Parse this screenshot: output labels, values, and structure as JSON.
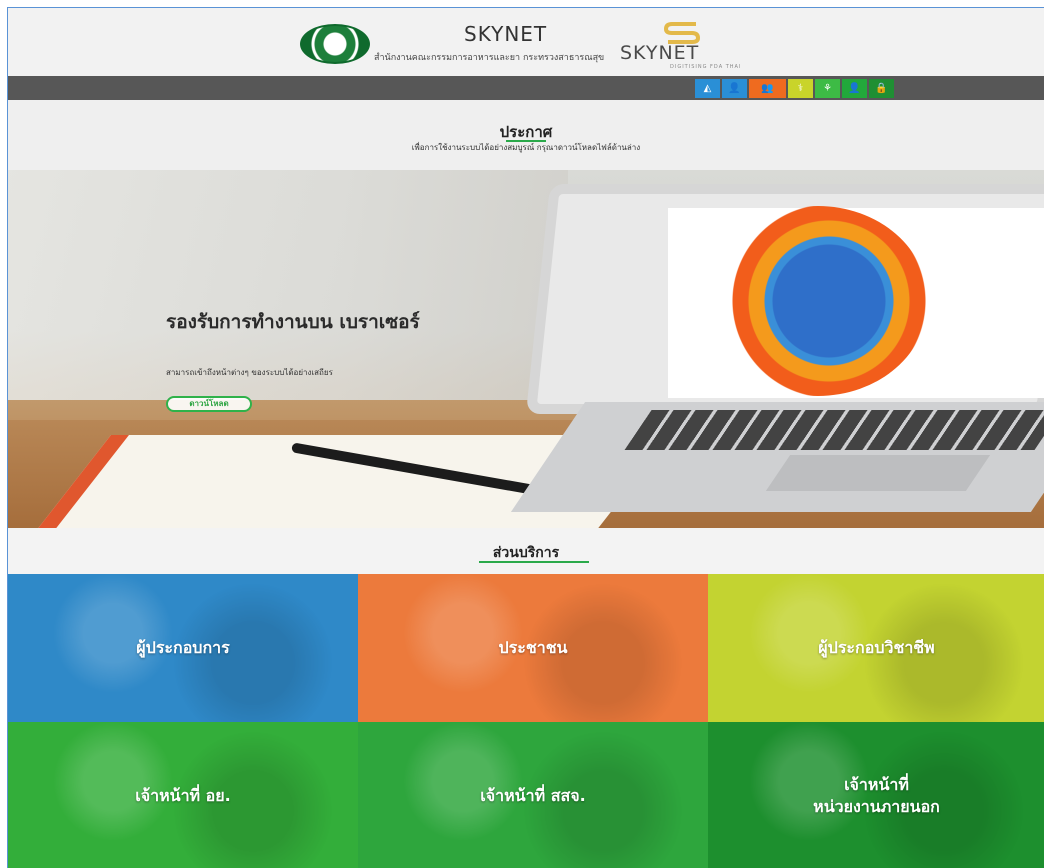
{
  "header": {
    "brand_title": "SKYNET",
    "brand_subtitle": "สำนักงานคณะกรรมการอาหารและยา กระทรวงสาธารณสุข",
    "logo_word": "SKYNET",
    "logo_tagline": "DIGITISING FDA THAI"
  },
  "nav": {
    "icons": [
      {
        "name": "logo-icon",
        "glyph": "◭",
        "color": "#2a8fd6"
      },
      {
        "name": "person-icon",
        "glyph": "👤",
        "color": "#2a8fd6"
      },
      {
        "name": "group-icon",
        "glyph": "👥",
        "color": "#ef6b1f"
      },
      {
        "name": "professional-icon",
        "glyph": "⚕",
        "color": "#c9d42a"
      },
      {
        "name": "signal-icon",
        "glyph": "⚘",
        "color": "#3dbb45"
      },
      {
        "name": "officer-icon",
        "glyph": "👤",
        "color": "#22a83b"
      },
      {
        "name": "lock-icon",
        "glyph": "🔒",
        "color": "#1f8f33"
      }
    ]
  },
  "announcement": {
    "title": "ประกาศ",
    "subtitle": "เพื่อการใช้งานระบบได้อย่างสมบูรณ์ กรุณาดาวน์โหลดไฟล์ด้านล่าง"
  },
  "hero": {
    "title": "รองรับการทำงานบน เบราเซอร์",
    "subtitle": "สามารถเข้าถึงหน้าต่างๆ ของระบบได้อย่างเสถียร",
    "button_label": "ดาวน์โหลด"
  },
  "services": {
    "title": "ส่วนบริการ",
    "tiles": [
      {
        "label": "ผู้ประกอบการ",
        "color": "#2f89c8"
      },
      {
        "label": "ประชาชน",
        "color": "#ec7a3c"
      },
      {
        "label": "ผู้ประกอบวิชาชีพ",
        "color": "#c3d331"
      },
      {
        "label": "เจ้าหน้าที่ อย.",
        "color": "#33ae3a"
      },
      {
        "label": "เจ้าหน้าที่ สสจ.",
        "color": "#2ea63d"
      },
      {
        "label": "เจ้าหน้าที่\nหน่วยงานภายนอก",
        "color": "#1d8f2e"
      }
    ]
  }
}
